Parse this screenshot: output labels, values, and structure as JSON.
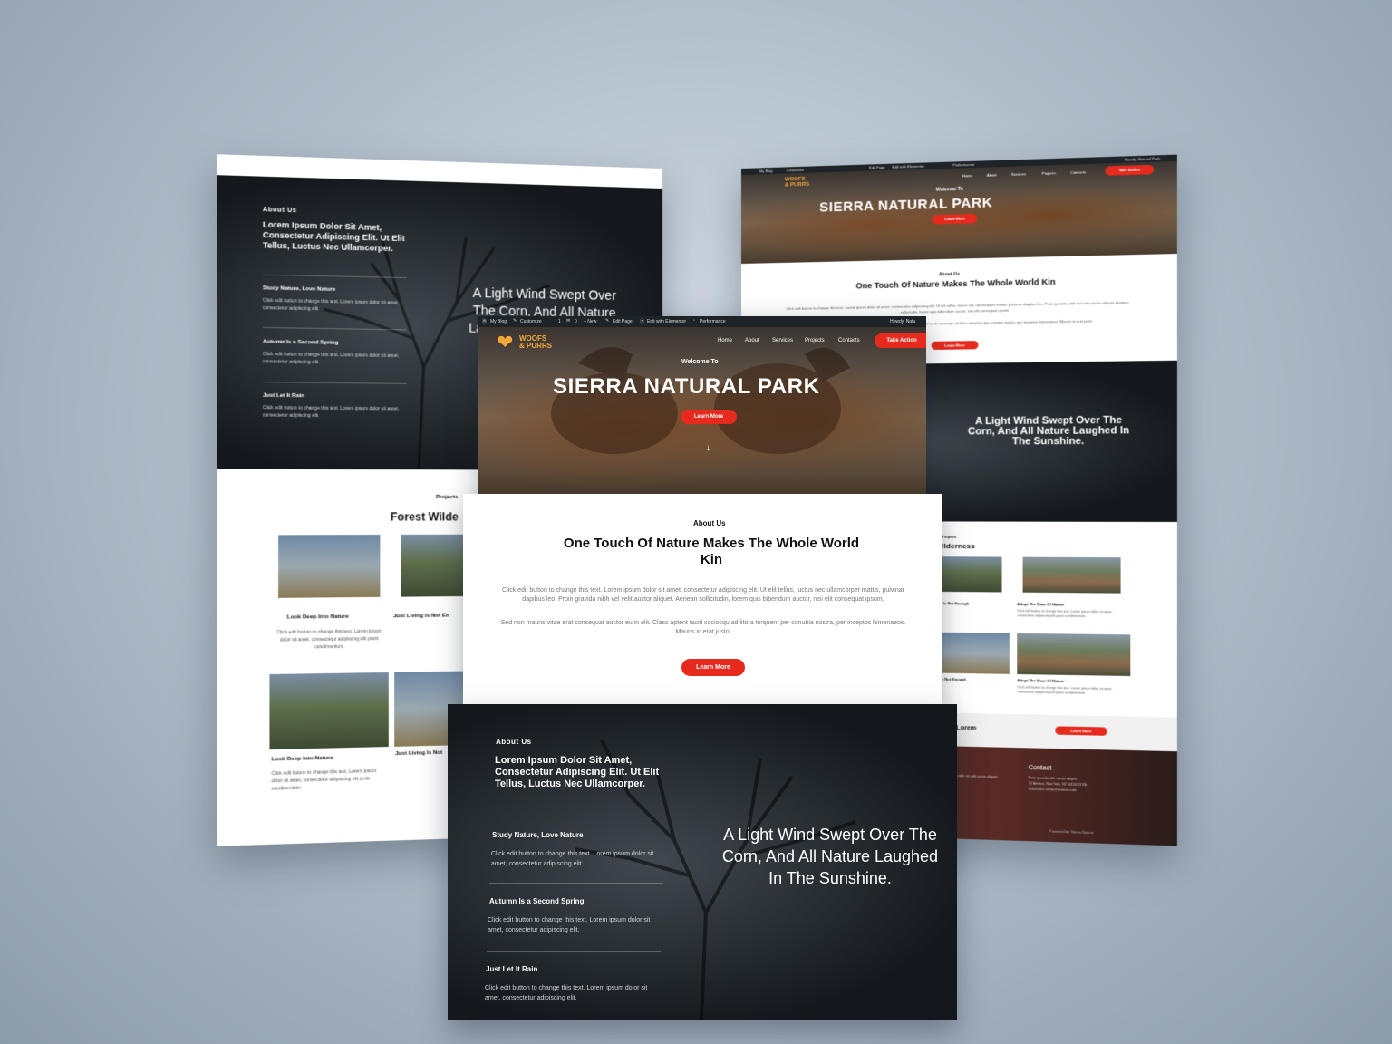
{
  "brand": {
    "logo_line1": "WOOFS",
    "logo_line2": "& PURRS"
  },
  "admin_bar": {
    "items": [
      "My Blog",
      "Customize",
      "1",
      "0",
      "+ New",
      "Edit Page",
      "Edit with Elementor",
      "Performance"
    ],
    "greeting": "Howdy, Natu",
    "greeting_right": "Howdy, Natural Park"
  },
  "nav": {
    "items": [
      "Home",
      "About",
      "Services",
      "Projects",
      "Contacts"
    ],
    "cta": "Take Action"
  },
  "hero": {
    "welcome": "Welcome To",
    "title": "SIERRA NATURAL PARK",
    "button": "Learn More",
    "arrow": "↓"
  },
  "about": {
    "eyebrow": "About Us",
    "heading": "One Touch Of Nature Makes The Whole World Kin",
    "para1": "Click edit button to change this text. Lorem ipsum dolor sit amet, consectetur adipiscing elit. Ut elit tellus, luctus nec ullamcorper mattis, pulvinar dapibus leo. Proin gravida nibh vel velit auctor aliquet. Aenean sollicitudin, lorem quis bibendum auctor, nisi elit consequat ipsum.",
    "para2": "Sed non mauris vitae erat consequat auctor eu in elit. Class aptent taciti sociosqu ad litora torquent per conubia nostra, per inceptos himenaeos. Mauris in erat justo.",
    "button": "Learn More"
  },
  "dark_section": {
    "eyebrow": "About Us",
    "heading": "Lorem Ipsum Dolor Sit Amet, Consectetur Adipiscing Elit. Ut Elit Tellus, Luctus Nec Ullamcorper.",
    "items": [
      {
        "title": "Study Nature, Love Nature",
        "text": "Click edit button to change this text. Lorem ipsum dolor sit amet, consectetur adipiscing elit."
      },
      {
        "title": "Autumn Is a Second Spring",
        "text": "Click edit button to change this text. Lorem ipsum dolor sit amet, consectetur adipiscing elit."
      },
      {
        "title": "Just Let It Rain",
        "text": "Click edit button to change this text. Lorem ipsum dolor sit amet, consectetur adipiscing elit."
      }
    ],
    "quote": "A Light Wind Swept Over The Corn, And All Nature Laughed In The Sunshine."
  },
  "projects": {
    "eyebrow": "Projects",
    "heading": "Forest Wilderness",
    "heading_left_crop": "Forest Wilde",
    "heading_right_crop": "t Wilderness",
    "cards": [
      {
        "title": "Look Deep Into Nature",
        "text": "Click edit button to change this text. Lorem ipsum dolor sit amet, consectetur adipiscing elit proin condimentum."
      },
      {
        "title": "Just Living Is Not Enough",
        "text": "Click edit button to change this text. Lorem ipsum dolor sit amet, consectetur adipiscing elit proin condimentum."
      },
      {
        "title": "Adopt The Pace Of Nature",
        "text": "Click edit button to change this text. Lorem ipsum dolor sit amet, consectetur adipiscing elit proin condimentum."
      }
    ],
    "crop_titles": {
      "left_second": "Just Living Is Not En",
      "left_bottom_second": "Just Living Is Not",
      "right_first": "Is Not Enough",
      "right_second": "s Not Enough"
    }
  },
  "cta_band": {
    "text_crop": "is Text Lorem",
    "button": "Learn More"
  },
  "footer": {
    "col1_crop": "ces",
    "col1_text": "Proin gravida nibh vel velit auctor aliquet.",
    "contact_heading": "Contact",
    "contact_lines": [
      "Proin gravida nibh auctor aliquet.",
      "12 Avenue, New York, NY 10160 11 Rb",
      "618-85325 contact@nature.com"
    ],
    "copyright": "Powered by Sierra Nature"
  },
  "colors": {
    "accent": "#e62b1e",
    "dark": "#15191c",
    "white": "#ffffff"
  },
  "icons": [
    "wordpress-icon",
    "home-icon",
    "brush-icon",
    "comment-icon",
    "plus-icon",
    "pencil-icon",
    "elementor-icon",
    "gauge-icon",
    "heart-paw-logo-icon",
    "arrow-down-icon"
  ]
}
